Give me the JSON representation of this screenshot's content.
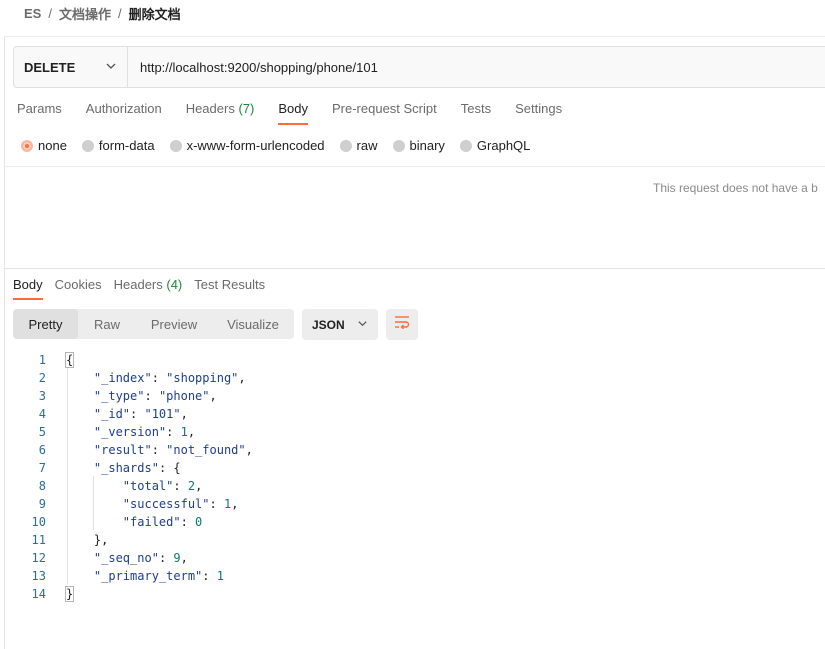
{
  "breadcrumb": {
    "items": [
      "ES",
      "文档操作"
    ],
    "separator": "/",
    "current": "删除文档"
  },
  "request": {
    "method": "DELETE",
    "url": "http://localhost:9200/shopping/phone/101"
  },
  "request_tabs": [
    {
      "label": "Params",
      "count": ""
    },
    {
      "label": "Authorization",
      "count": ""
    },
    {
      "label": "Headers",
      "count": "(7)"
    },
    {
      "label": "Body",
      "count": ""
    },
    {
      "label": "Pre-request Script",
      "count": ""
    },
    {
      "label": "Tests",
      "count": ""
    },
    {
      "label": "Settings",
      "count": ""
    }
  ],
  "body_types": [
    "none",
    "form-data",
    "x-www-form-urlencoded",
    "raw",
    "binary",
    "GraphQL"
  ],
  "no_body_message": "This request does not have a b",
  "response_tabs": [
    {
      "label": "Body",
      "count": ""
    },
    {
      "label": "Cookies",
      "count": ""
    },
    {
      "label": "Headers",
      "count": "(4)"
    },
    {
      "label": "Test Results",
      "count": ""
    }
  ],
  "view_modes": [
    "Pretty",
    "Raw",
    "Preview",
    "Visualize"
  ],
  "format": "JSON",
  "code": {
    "line_numbers": [
      "1",
      "2",
      "3",
      "4",
      "5",
      "6",
      "7",
      "8",
      "9",
      "10",
      "11",
      "12",
      "13",
      "14"
    ],
    "open_brace": "{",
    "close_brace": "}",
    "f_index": {
      "key": "\"_index\"",
      "value": "\"shopping\""
    },
    "f_type": {
      "key": "\"_type\"",
      "value": "\"phone\""
    },
    "f_id": {
      "key": "\"_id\"",
      "value": "\"101\""
    },
    "f_version": {
      "key": "\"_version\"",
      "value": "1"
    },
    "f_result": {
      "key": "\"result\"",
      "value": "\"not_found\""
    },
    "f_shards": {
      "key": "\"_shards\"",
      "open": "{"
    },
    "f_total": {
      "key": "\"total\"",
      "value": "2"
    },
    "f_successful": {
      "key": "\"successful\"",
      "value": "1"
    },
    "f_failed": {
      "key": "\"failed\"",
      "value": "0"
    },
    "shards_close": "},",
    "f_seq_no": {
      "key": "\"_seq_no\"",
      "value": "9"
    },
    "f_primary_term": {
      "key": "\"_primary_term\"",
      "value": "1"
    }
  },
  "colors": {
    "accent": "#ff6c37",
    "count_green": "#1a8b3c"
  }
}
